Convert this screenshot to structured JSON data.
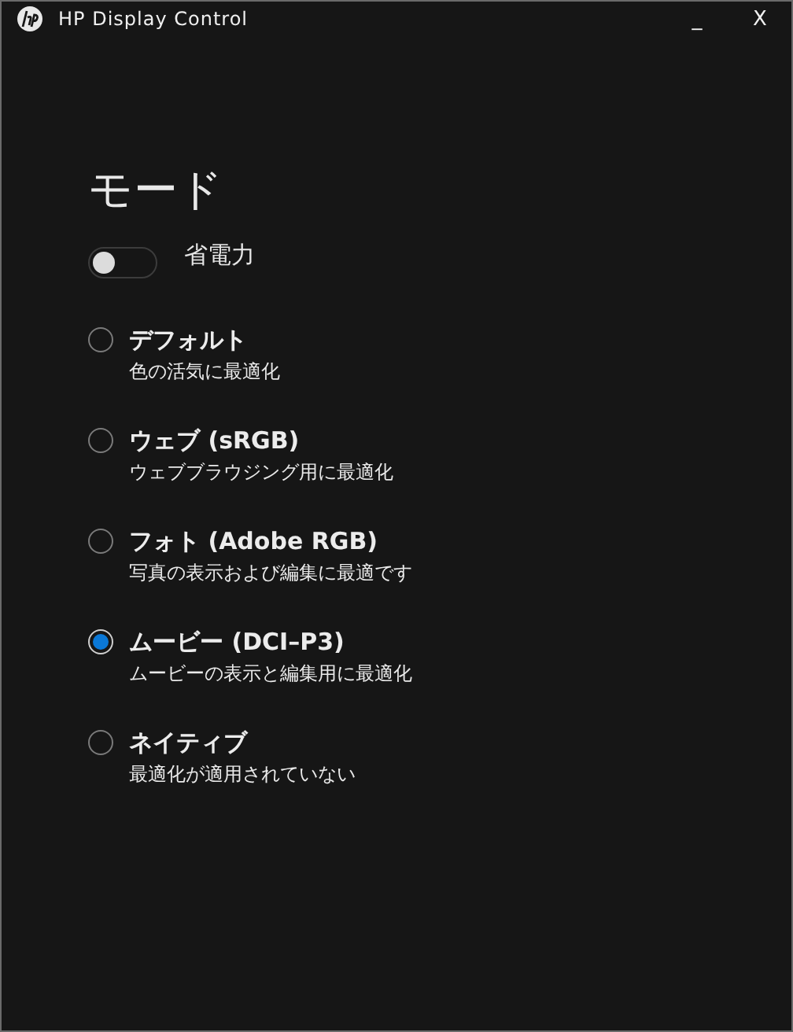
{
  "window": {
    "title": "HP Display Control",
    "minimize": "_",
    "close": "X"
  },
  "heading": "モード",
  "power_saving": {
    "label": "省電力",
    "on": false
  },
  "modes": [
    {
      "title": "デフォルト",
      "description": "色の活気に最適化",
      "selected": false
    },
    {
      "title": "ウェブ (sRGB)",
      "description": "ウェブブラウジング用に最適化",
      "selected": false
    },
    {
      "title": "フォト (Adobe RGB)",
      "description": "写真の表示および編集に最適です",
      "selected": false
    },
    {
      "title": "ムービー (DCI–P3)",
      "description": "ムービーの表示と編集用に最適化",
      "selected": true
    },
    {
      "title": "ネイティブ",
      "description": "最適化が適用されていない",
      "selected": false
    }
  ]
}
